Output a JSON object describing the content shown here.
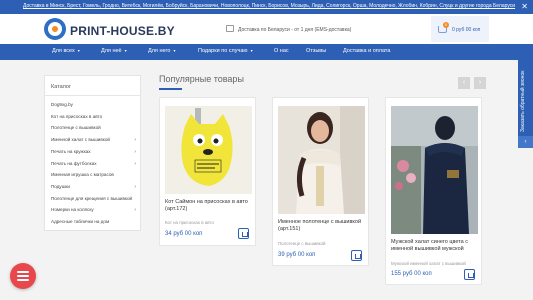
{
  "topbar": {
    "text": "Доставка в Минск, Брест, Гомель, Гродно, Витебск, Могилёв, Бобруйск, Барановичи, Новополоцк, Пинск, Борисов, Мозырь, Лида, Солигорск, Орша, Молодечно, Жлобин, Кобрин, Слуцк и другие города Беларуси",
    "close": "✕"
  },
  "header": {
    "logo_text": "PRINT-HOUSE.BY",
    "delivery_text": "Доставка по Беларуси - от 1 дня (ЕМS-доставка)",
    "cart_total": "0 руб 00 коп",
    "cart_count": "0"
  },
  "nav": {
    "items": [
      {
        "label": "Для всех",
        "caret": "▾"
      },
      {
        "label": "Для неё",
        "caret": "▾"
      },
      {
        "label": "Для него",
        "caret": "▾"
      },
      {
        "label": "Подарки по случаю",
        "caret": "▾"
      },
      {
        "label": "О нас",
        "caret": ""
      },
      {
        "label": "Отзывы",
        "caret": ""
      },
      {
        "label": "Доставка и оплата",
        "caret": ""
      }
    ]
  },
  "sidebar": {
    "title": "Каталог",
    "items": [
      {
        "label": "Dog9xg.by",
        "chevron": ""
      },
      {
        "label": "Кот на присосках в авто",
        "chevron": ""
      },
      {
        "label": "Полотенце с вышивкой",
        "chevron": ""
      },
      {
        "label": "Именной халат с вышивкой",
        "chevron": "›"
      },
      {
        "label": "Печать на кружках",
        "chevron": "›"
      },
      {
        "label": "Печать на футболках",
        "chevron": "›"
      },
      {
        "label": "Именная игрушка с матрасов",
        "chevron": ""
      },
      {
        "label": "Подушки",
        "chevron": "›"
      },
      {
        "label": "Полотенце для крещения с вышивкой",
        "chevron": ""
      },
      {
        "label": "Номерки на коляску",
        "chevron": "›"
      },
      {
        "label": "Адресные таблички на дом",
        "chevron": ""
      }
    ]
  },
  "main": {
    "section_title": "Популярные товары",
    "prev_arrow": "‹",
    "next_arrow": "›",
    "products": [
      {
        "name": "Кот Саймон на присосках в авто (арт.172)",
        "category": "Кот на присосках в авто",
        "price": "34 руб 00 коп"
      },
      {
        "name": "Именное полотенце с вышивкой (арт.151)",
        "category": "Полотенце с вышивкой",
        "price": "39 руб 00 коп"
      },
      {
        "name": "Мужской халат синего цвета с именной вышивкой мужской",
        "category": "Мужской именной халат с вышивкой",
        "price": "155 руб 00 коп"
      }
    ]
  },
  "callback": {
    "label": "Заказать обратный звонок",
    "arrow": "‹"
  },
  "colors": {
    "brand_blue": "#2d60b4",
    "accent_orange": "#f28c28",
    "fab_red": "#e8474b"
  }
}
